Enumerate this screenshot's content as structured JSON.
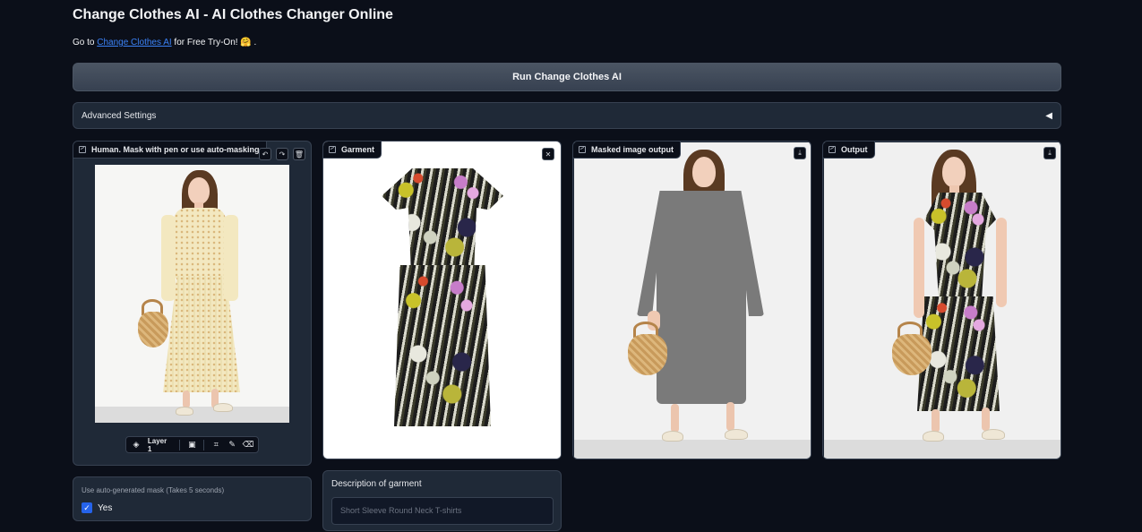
{
  "header": {
    "title": "Change Clothes AI - AI Clothes Changer Online",
    "sub_prefix": "Go to",
    "sub_link": "Change Clothes AI",
    "sub_suffix": "for Free Try-On! 🤗 ."
  },
  "run_button": {
    "label": "Run Change Clothes AI"
  },
  "advanced": {
    "label": "Advanced Settings",
    "icon": "triangle-left-icon"
  },
  "panels": {
    "human": {
      "label": "Human. Mask with pen or use auto-masking",
      "buttons": [
        "undo-icon",
        "redo-icon",
        "trash-icon"
      ]
    },
    "garment": {
      "label": "Garment",
      "close": "close-icon"
    },
    "masked": {
      "label": "Masked image output",
      "download": "download-icon"
    },
    "output": {
      "label": "Output",
      "download": "download-icon"
    }
  },
  "toolbar": {
    "layer_label": "Layer 1",
    "icons": [
      "layers-icon",
      "image-icon",
      "crop-icon",
      "brush-icon",
      "eraser-icon"
    ]
  },
  "mask_option": {
    "label": "Use auto-generated mask (Takes 5 seconds)",
    "checkbox_label": "Yes",
    "checked": true
  },
  "description": {
    "label": "Description of garment",
    "placeholder": "Short Sleeve Round Neck T-shirts",
    "value": ""
  },
  "colors": {
    "background": "#0b0f19",
    "panel": "#1f2937",
    "accent": "#2563eb",
    "link": "#3b82f6"
  }
}
